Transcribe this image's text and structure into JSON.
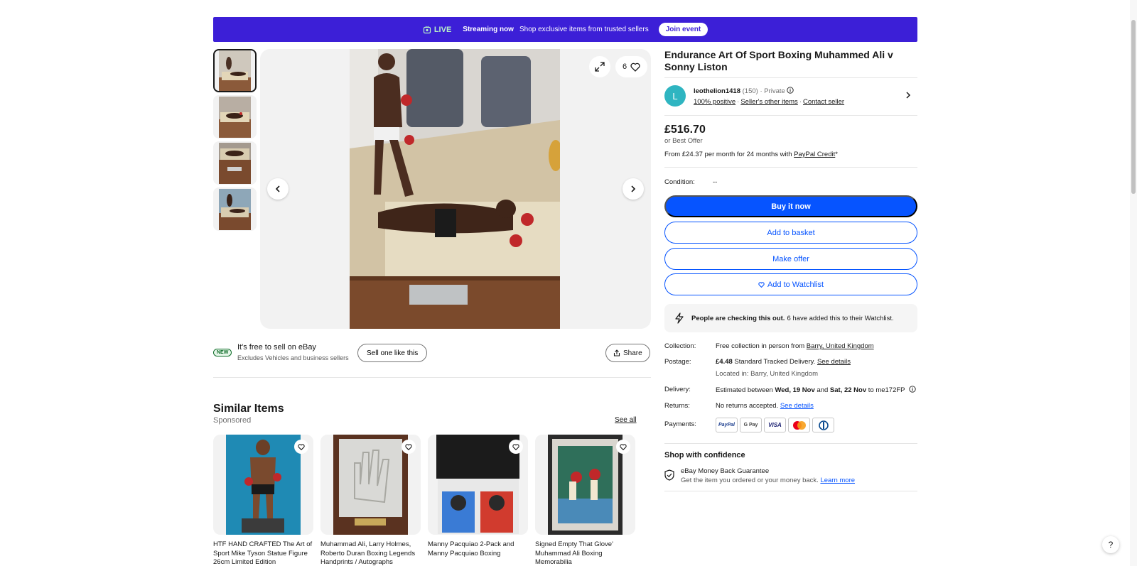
{
  "banner": {
    "live_label": "LIVE",
    "streaming": "Streaming now",
    "tagline": "Shop exclusive items from trusted sellers",
    "join_label": "Join event"
  },
  "gallery": {
    "watch_count": "6"
  },
  "sell": {
    "badge": "NEW",
    "title": "It's free to sell on eBay",
    "subtitle": "Excludes Vehicles and business sellers",
    "button": "Sell one like this",
    "share": "Share"
  },
  "similar": {
    "title": "Similar Items",
    "sponsored": "Sponsored",
    "see_all": "See all",
    "cards": [
      {
        "title": "HTF HAND CRAFTED The Art of Sport Mike Tyson Statue Figure 26cm Limited Edition"
      },
      {
        "title": "Muhammad Ali, Larry Holmes, Roberto Duran Boxing Legends Handprints / Autographs"
      },
      {
        "title": "Manny Pacquiao 2-Pack and Manny Pacquiao Boxing"
      },
      {
        "title": "Signed Empty That Glove' Muhammad Ali Boxing Memorabilia"
      }
    ]
  },
  "item": {
    "title": "Endurance Art Of Sport Boxing Muhammed Ali v Sonny Liston",
    "price": "£516.70",
    "best_offer": "or Best Offer",
    "finance_prefix": "From £24.37 per month for 24 months with ",
    "finance_link": "PayPal Credit",
    "finance_suffix": "*",
    "condition_label": "Condition:",
    "condition_value": "--"
  },
  "seller": {
    "initial": "L",
    "name": "leothelion1418",
    "feedback": "(150)",
    "type": "· Private",
    "positive": "100% positive",
    "other_items": "Seller's other items",
    "contact": "Contact seller"
  },
  "actions": {
    "buy": "Buy it now",
    "basket": "Add to basket",
    "offer": "Make offer",
    "watch": "Add to Watchlist"
  },
  "people": {
    "bold": "People are checking this out.",
    "rest": "6 have added this to their Watchlist."
  },
  "specs": {
    "collection_label": "Collection:",
    "collection_text": "Free collection in person from ",
    "collection_link": "Barry, United Kingdom",
    "postage_label": "Postage:",
    "postage_price": "£4.48",
    "postage_text": " Standard Tracked Delivery. ",
    "postage_link": "See details",
    "located": "Located in: Barry, United Kingdom",
    "delivery_label": "Delivery:",
    "delivery_prefix": "Estimated between ",
    "delivery_from": "Wed, 19 Nov",
    "delivery_and": " and ",
    "delivery_to": "Sat, 22 Nov",
    "delivery_suffix": " to me172FP",
    "returns_label": "Returns:",
    "returns_text": "No returns accepted. ",
    "returns_link": "See details",
    "payments_label": "Payments:",
    "payment_methods": [
      "PayPal",
      "G Pay",
      "VISA",
      "Mastercard",
      "Diners"
    ]
  },
  "confidence": {
    "title": "Shop with confidence",
    "guarantee_title": "eBay Money Back Guarantee",
    "guarantee_sub": "Get the item you ordered or your money back. ",
    "learn_more": "Learn more"
  },
  "colors": {
    "banner": "#3c1fd7",
    "accent_blue": "#0654ff",
    "avatar": "#2fb5c1"
  },
  "help": "?"
}
